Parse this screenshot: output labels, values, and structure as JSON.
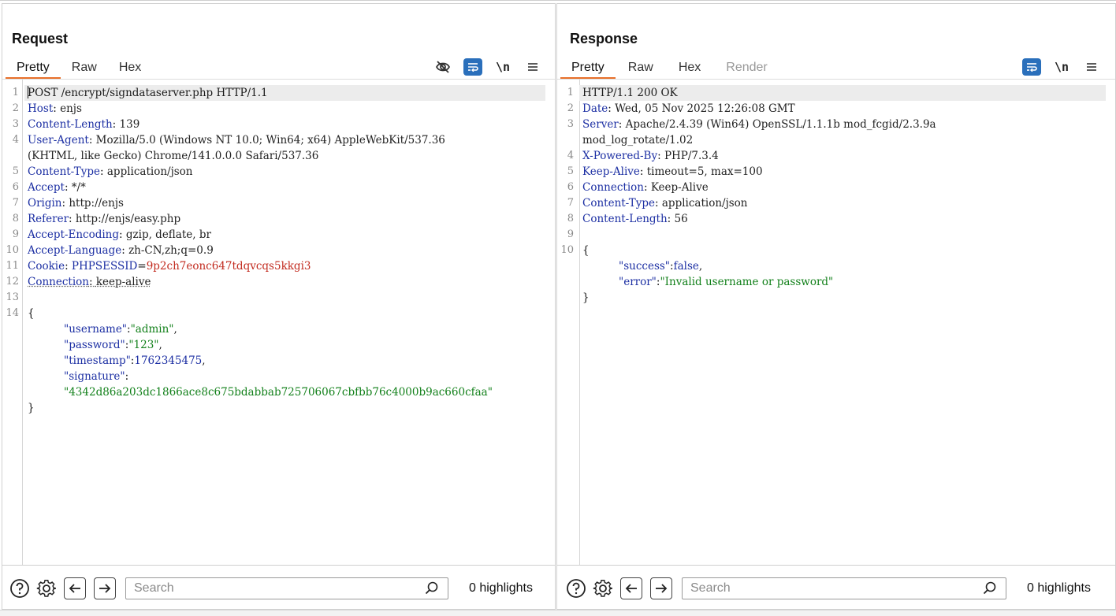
{
  "layout_switch": {
    "options": [
      "split-columns",
      "split-rows",
      "single"
    ],
    "active": "split-columns",
    "accent": "#2a6fbb"
  },
  "request": {
    "title": "Request",
    "tabs": [
      {
        "label": "Pretty",
        "active": true
      },
      {
        "label": "Raw",
        "active": false
      },
      {
        "label": "Hex",
        "active": false
      }
    ],
    "newline_label": "\\n",
    "lines": {
      "l1": {
        "n": "1",
        "text": "POST /encrypt/signdataserver.php HTTP/1.1"
      },
      "l2": {
        "n": "2",
        "key": "Host",
        "value": "enjs"
      },
      "l3": {
        "n": "3",
        "key": "Content-Length",
        "value": "139"
      },
      "l4": {
        "n": "4",
        "key": "User-Agent",
        "value": "Mozilla/5.0 (Windows NT 10.0; Win64; x64) AppleWebKit/537.36",
        "cont": "(KHTML, like Gecko) Chrome/141.0.0.0 Safari/537.36"
      },
      "l5": {
        "n": "5",
        "key": "Content-Type",
        "value": "application/json"
      },
      "l6": {
        "n": "6",
        "key": "Accept",
        "value": "*/*"
      },
      "l7": {
        "n": "7",
        "key": "Origin",
        "value": "http://enjs"
      },
      "l8": {
        "n": "8",
        "key": "Referer",
        "value": "http://enjs/easy.php"
      },
      "l9": {
        "n": "9",
        "key": "Accept-Encoding",
        "value": "gzip, deflate, br"
      },
      "l10": {
        "n": "10",
        "key": "Accept-Language",
        "value": "zh-CN,zh;q=0.9"
      },
      "l11": {
        "n": "11",
        "key": "Cookie",
        "cookie_name": "PHPSESSID",
        "cookie_value": "9p2ch7eonc647tdqvcqs5kkgi3"
      },
      "l12": {
        "n": "12",
        "key": "Connection",
        "value": "keep-alive"
      },
      "l13": {
        "n": "13"
      },
      "l14": {
        "n": "14",
        "text": "{"
      },
      "json": {
        "username_key": "\"username\"",
        "username_val": "\"admin\"",
        "password_key": "\"password\"",
        "password_val": "\"123\"",
        "timestamp_key": "\"timestamp\"",
        "timestamp_val": "1762345475",
        "signature_key": "\"signature\"",
        "signature_val": "\"4342d86a203dc1866ace8c675bdabbab725706067cbfbb76c4000b9ac660cfaa\"",
        "close": "}"
      }
    },
    "search": {
      "placeholder": "Search",
      "highlights": "0 highlights"
    }
  },
  "response": {
    "title": "Response",
    "tabs": [
      {
        "label": "Pretty",
        "active": true
      },
      {
        "label": "Raw",
        "active": false
      },
      {
        "label": "Hex",
        "active": false
      },
      {
        "label": "Render",
        "active": false
      }
    ],
    "newline_label": "\\n",
    "lines": {
      "l1": {
        "n": "1",
        "text": "HTTP/1.1 200 OK"
      },
      "l2": {
        "n": "2",
        "key": "Date",
        "value": "Wed, 05 Nov 2025 12:26:08 GMT"
      },
      "l3": {
        "n": "3",
        "key": "Server",
        "value": "Apache/2.4.39 (Win64) OpenSSL/1.1.1b mod_fcgid/2.3.9a",
        "cont": "mod_log_rotate/1.02"
      },
      "l4": {
        "n": "4",
        "key": "X-Powered-By",
        "value": "PHP/7.3.4"
      },
      "l5": {
        "n": "5",
        "key": "Keep-Alive",
        "value": "timeout=5, max=100"
      },
      "l6": {
        "n": "6",
        "key": "Connection",
        "value": "Keep-Alive"
      },
      "l7": {
        "n": "7",
        "key": "Content-Type",
        "value": "application/json"
      },
      "l8": {
        "n": "8",
        "key": "Content-Length",
        "value": "56"
      },
      "l9": {
        "n": "9"
      },
      "l10": {
        "n": "10",
        "text": "{"
      },
      "json": {
        "success_key": "\"success\"",
        "success_val": "false",
        "error_key": "\"error\"",
        "error_val": "\"Invalid username or password\"",
        "close": "}"
      }
    },
    "search": {
      "placeholder": "Search",
      "highlights": "0 highlights"
    }
  },
  "colors": {
    "tab_underline": "#e8702a",
    "header_key": "#1c2fa3",
    "cookie_value": "#c22a1e",
    "json_string": "#12801a"
  }
}
